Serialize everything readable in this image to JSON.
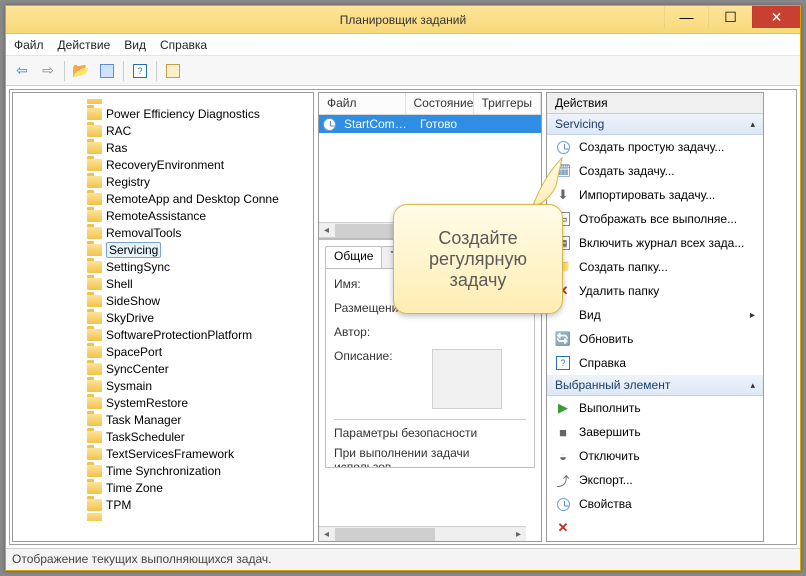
{
  "window": {
    "title": "Планировщик заданий"
  },
  "menu": {
    "file": "Файл",
    "action": "Действие",
    "view": "Вид",
    "help": "Справка"
  },
  "tree": {
    "items": [
      "Power Efficiency Diagnostics",
      "RAC",
      "Ras",
      "RecoveryEnvironment",
      "Registry",
      "RemoteApp and Desktop Conne",
      "RemoteAssistance",
      "RemovalTools",
      "Servicing",
      "SettingSync",
      "Shell",
      "SideShow",
      "SkyDrive",
      "SoftwareProtectionPlatform",
      "SpacePort",
      "SyncCenter",
      "Sysmain",
      "SystemRestore",
      "Task Manager",
      "TaskScheduler",
      "TextServicesFramework",
      "Time Synchronization",
      "Time Zone",
      "TPM"
    ],
    "selected": "Servicing"
  },
  "tasks": {
    "cols": {
      "file": "Файл",
      "state": "Состояние",
      "triggers": "Триггеры"
    },
    "row": {
      "name": "StartCompo...",
      "state": "Готово"
    }
  },
  "detail": {
    "tabs": {
      "general": "Общие",
      "triggers_short": "Тр"
    },
    "labels": {
      "name": "Имя:",
      "location": "Размещение",
      "author": "Автор:",
      "description": "Описание:",
      "security": "Параметры безопасности",
      "runas": "При выполнении задачи использов"
    }
  },
  "actions": {
    "header": "Действия",
    "group1_title": "Servicing",
    "group1": [
      "Создать простую задачу...",
      "Создать задачу...",
      "Импортировать задачу...",
      "Отображать все выполняе...",
      "Включить журнал всех зада...",
      "Создать папку...",
      "Удалить папку",
      "Вид",
      "Обновить",
      "Справка"
    ],
    "group2_title": "Выбранный элемент",
    "group2": [
      "Выполнить",
      "Завершить",
      "Отключить",
      "Экспорт...",
      "Свойства"
    ]
  },
  "statusbar": "Отображение текущих выполняющихся задач.",
  "callout": "Создайте регулярную задачу"
}
